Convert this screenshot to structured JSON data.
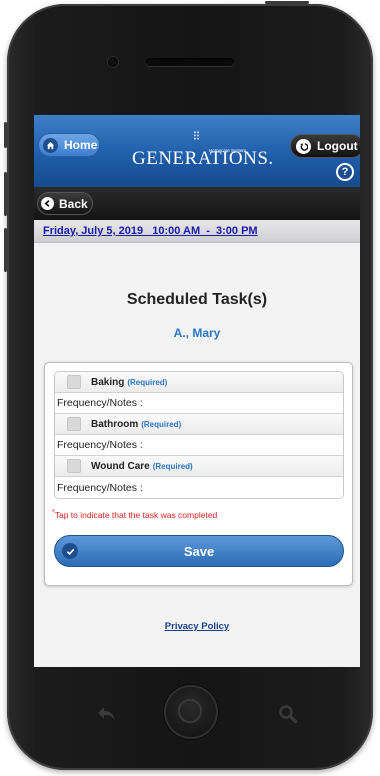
{
  "header": {
    "home_label": "Home",
    "logo_text": "GENERATIONS.",
    "logo_sub": "Homecare System",
    "logout_label": "Logout",
    "help_label": "?"
  },
  "nav": {
    "back_label": "Back"
  },
  "date_bar": {
    "text": "Friday, July 5, 2019   10:00 AM  -  3:00 PM"
  },
  "main": {
    "title": "Scheduled Task(s)",
    "client_name": "A., Mary",
    "tasks": [
      {
        "name": "Baking",
        "required_label": "(Required)",
        "freq_label": "Frequency/Notes :"
      },
      {
        "name": "Bathroom",
        "required_label": "(Required)",
        "freq_label": "Frequency/Notes :"
      },
      {
        "name": "Wound Care",
        "required_label": "(Required)",
        "freq_label": "Frequency/Notes :"
      }
    ],
    "note_marker": "*",
    "note_text": "Tap to indicate that the task was completed",
    "save_label": "Save",
    "privacy_label": "Privacy Policy"
  },
  "colors": {
    "header_blue": "#1f5eaa",
    "accent_blue": "#2a76c4",
    "link_blue": "#1a1aaa",
    "note_red": "#e02020"
  },
  "icons": {
    "home": "home-icon",
    "logout": "logout-icon",
    "help": "help-icon",
    "back": "back-arrow-icon",
    "save": "check-icon"
  }
}
